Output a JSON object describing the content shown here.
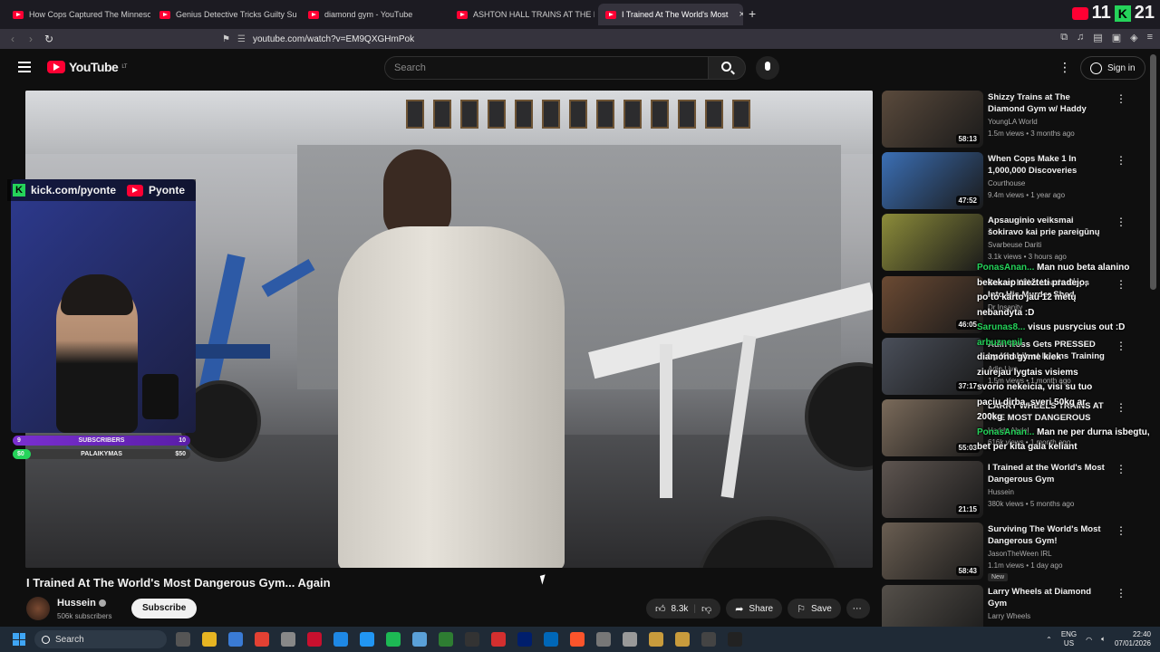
{
  "browser": {
    "tabs": [
      {
        "title": "How Cops Captured The Minnesota I"
      },
      {
        "title": "Genius Detective Tricks Guilty Suspe"
      },
      {
        "title": "diamond gym - YouTube"
      },
      {
        "title": "ASHTON HALL TRAINS AT THE MOST"
      },
      {
        "title": "I Trained At The World's Most",
        "active": true
      }
    ],
    "url": "youtube.com/watch?v=EM9QXGHmPok",
    "overlay_counter": {
      "youtube": "11",
      "kick": "21"
    }
  },
  "youtube": {
    "logo": "YouTube",
    "logo_region": "LT",
    "search_placeholder": "Search",
    "signin_label": "Sign in"
  },
  "stream_overlay": {
    "kick_handle": "kick.com/pyonte",
    "youtube_handle": "Pyonte",
    "goal1": {
      "left": "9",
      "label": "SUBSCRIBERS",
      "right": "10"
    },
    "goal2": {
      "left": "$0",
      "label": "PALAIKYMAS",
      "right": "$50"
    }
  },
  "chat": [
    {
      "user": "PonasAnan...",
      "text": "Man nuo beta alanino"
    },
    {
      "user": "",
      "text": "bekekaip niežteti pradėjo,"
    },
    {
      "user": "",
      "text": "po to karto jau 12 metų"
    },
    {
      "user": "",
      "text": "nebandyta :D"
    },
    {
      "user": "Sarunas8...",
      "text": "visus pusrycius out :D"
    },
    {
      "user": "arbuznepil",
      "text": ""
    },
    {
      "user": "",
      "text": "diamond gyme kiek"
    },
    {
      "user": "",
      "text": "ziurejau lygtais visiems"
    },
    {
      "user": "",
      "text": "svorio nekeicia, visi su tuo"
    },
    {
      "user": "",
      "text": "paciu dirba, sveri 50kg ar"
    },
    {
      "user": "",
      "text": "200kg"
    },
    {
      "user": "PonasAnan...",
      "text": "Man ne per durna isbegtu,"
    },
    {
      "user": "",
      "text": "bet per kita gala keliant"
    }
  ],
  "video": {
    "title": "I Trained At The World's Most Dangerous Gym... Again",
    "channel": "Hussein",
    "subscribers": "506k subscribers",
    "subscribe_label": "Subscribe",
    "likes": "8.3k",
    "share_label": "Share",
    "save_label": "Save"
  },
  "recommended": [
    {
      "title": "Shizzy Trains at The Diamond Gym w/ Haddy Abdel",
      "channel": "YoungLA World",
      "meta": "1.5m views • 3 months ago",
      "duration": "58:13",
      "color": "#5a4a3c"
    },
    {
      "title": "When Cops Make 1 In 1,000,000 Discoveries",
      "channel": "Courthouse",
      "meta": "9.4m views • 1 year ago",
      "duration": "47:52",
      "color": "#3b6fb5"
    },
    {
      "title": "Apsauginio veiksmai šokiravo kai prie pareigūnų akių buvo ...",
      "channel": "Svarbeuse Dariti",
      "meta": "3.1k views • 3 hours ago",
      "duration": "",
      "color": "#8c8c3a"
    },
    {
      "title": "Secret Killer Leads Cops Into His Murder Shed",
      "channel": "Dr Insanity",
      "meta": "",
      "duration": "46:05",
      "color": "#6b4a33"
    },
    {
      "title": "Adin Ross Gets PRESSED by Khabib at Islams Training",
      "channel": "Adin Live",
      "meta": "1.5m views • 1 month ago",
      "duration": "37:17",
      "color": "#4a4f5a"
    },
    {
      "title": "LARRY WHEELS TRAINS AT THE MOST DANGEROUS GYM",
      "channel": "Haddy Abdel",
      "meta": "616k views • 1 month ago",
      "duration": "55:03",
      "color": "#7a6a5a"
    },
    {
      "title": "I Trained at the World's Most Dangerous Gym",
      "channel": "Hussein",
      "meta": "380k views • 5 months ago",
      "duration": "21:15",
      "color": "#5e5550"
    },
    {
      "title": "Surviving The World's Most Dangerous Gym!",
      "channel": "JasonTheWeen IRL",
      "meta": "1.1m views • 1 day ago",
      "duration": "58:43",
      "color": "#6a5e52",
      "badge": "New"
    },
    {
      "title": "Larry Wheels at Diamond Gym",
      "channel": "Larry Wheels",
      "meta": "",
      "duration": "",
      "color": "#55504a"
    }
  ],
  "taskbar": {
    "search_label": "Search",
    "lang": "ENG",
    "region": "US",
    "time": "22:40",
    "date": "07/01/2026",
    "app_colors": [
      "#555",
      "#e6b422",
      "#3a7bd5",
      "#e34133",
      "#888",
      "#c8102e",
      "#1e88e5",
      "#2196f3",
      "#1db954",
      "#5aa0d8",
      "#2e7d32",
      "#333",
      "#d32f2f",
      "#001e6c",
      "#0067b8",
      "#fb542b",
      "#777",
      "#999",
      "#c89b3c",
      "#c89b3c",
      "#444",
      "#222"
    ]
  }
}
